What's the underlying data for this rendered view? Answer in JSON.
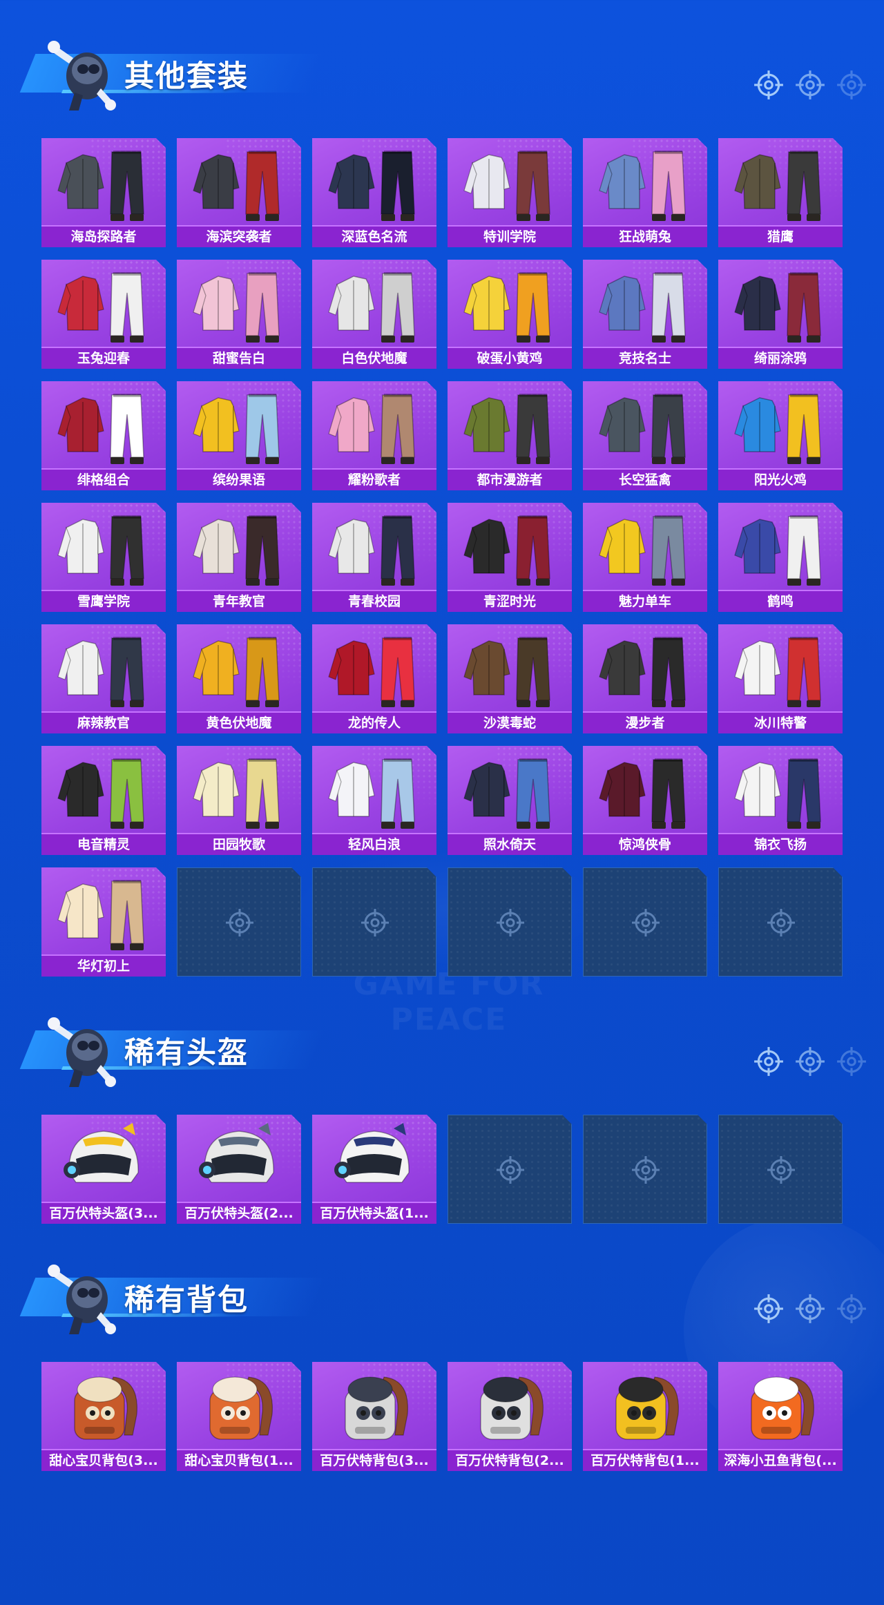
{
  "watermark": "GAME FOR PEACE",
  "sections": [
    {
      "id": "outfits",
      "title": "其他套装",
      "art": "outfit",
      "empty_slots": 5,
      "items": [
        {
          "label": "海岛探路者",
          "c1": "#4a5058",
          "c2": "#2a2e36"
        },
        {
          "label": "海滨突袭者",
          "c1": "#3a3d45",
          "c2": "#b02a2a"
        },
        {
          "label": "深蓝色名流",
          "c1": "#2c3650",
          "c2": "#1a1f2e"
        },
        {
          "label": "特训学院",
          "c1": "#e8e8f0",
          "c2": "#7a3a3a"
        },
        {
          "label": "狂战萌兔",
          "c1": "#6a8ac8",
          "c2": "#e8a0c8"
        },
        {
          "label": "猎鹰",
          "c1": "#5c5440",
          "c2": "#3a3a3a"
        },
        {
          "label": "玉兔迎春",
          "c1": "#c82a3a",
          "c2": "#f0f0f0"
        },
        {
          "label": "甜蜜告白",
          "c1": "#f2c4d6",
          "c2": "#e8a0c0"
        },
        {
          "label": "白色伏地魔",
          "c1": "#e6e6e6",
          "c2": "#cfcfcf"
        },
        {
          "label": "破蛋小黄鸡",
          "c1": "#f5d23a",
          "c2": "#f0a020"
        },
        {
          "label": "竞技名士",
          "c1": "#5c78c0",
          "c2": "#d8dce8"
        },
        {
          "label": "绮丽涂鸦",
          "c1": "#2a2e48",
          "c2": "#8a2a3a"
        },
        {
          "label": "绯格组合",
          "c1": "#a82030",
          "c2": "#ffffff"
        },
        {
          "label": "缤纷果语",
          "c1": "#f2c020",
          "c2": "#9ec8e8"
        },
        {
          "label": "耀粉歌者",
          "c1": "#f0a8c8",
          "c2": "#b08870"
        },
        {
          "label": "都市漫游者",
          "c1": "#6a7a30",
          "c2": "#3a3a3a"
        },
        {
          "label": "长空猛禽",
          "c1": "#4a5560",
          "c2": "#3a4048"
        },
        {
          "label": "阳光火鸡",
          "c1": "#2a8ae0",
          "c2": "#f2c020"
        },
        {
          "label": "雪鹰学院",
          "c1": "#f0f0f0",
          "c2": "#303030"
        },
        {
          "label": "青年教官",
          "c1": "#e8e0d8",
          "c2": "#3a2a2a"
        },
        {
          "label": "青春校园",
          "c1": "#e8e8e8",
          "c2": "#2a3048"
        },
        {
          "label": "青涩时光",
          "c1": "#2a2a2a",
          "c2": "#8a2030"
        },
        {
          "label": "魅力单车",
          "c1": "#f2c820",
          "c2": "#7a8aa0"
        },
        {
          "label": "鹤鸣",
          "c1": "#3a4aa8",
          "c2": "#f0f0f0"
        },
        {
          "label": "麻辣教官",
          "c1": "#f0f0f0",
          "c2": "#303848"
        },
        {
          "label": "黄色伏地魔",
          "c1": "#f0b020",
          "c2": "#d89818"
        },
        {
          "label": "龙的传人",
          "c1": "#b01828",
          "c2": "#e83040"
        },
        {
          "label": "沙漠毒蛇",
          "c1": "#6a4a30",
          "c2": "#4a3a28"
        },
        {
          "label": "漫步者",
          "c1": "#3a3a3a",
          "c2": "#2a2a2a"
        },
        {
          "label": "冰川特警",
          "c1": "#f4f4f4",
          "c2": "#d03030"
        },
        {
          "label": "电音精灵",
          "c1": "#2a2a2a",
          "c2": "#8ac040"
        },
        {
          "label": "田园牧歌",
          "c1": "#f4ecc8",
          "c2": "#e8d890"
        },
        {
          "label": "轻风白浪",
          "c1": "#f4f4f8",
          "c2": "#a8c8e8"
        },
        {
          "label": "照水倚天",
          "c1": "#2a3048",
          "c2": "#4a78c8"
        },
        {
          "label": "惊鸿侠骨",
          "c1": "#5a1a2a",
          "c2": "#2a2a2a"
        },
        {
          "label": "锦衣飞扬",
          "c1": "#f4f4f4",
          "c2": "#2a3868"
        },
        {
          "label": "华灯初上",
          "c1": "#f6e6c8",
          "c2": "#d8b890"
        }
      ]
    },
    {
      "id": "helmets",
      "title": "稀有头盔",
      "art": "helmet",
      "empty_slots": 3,
      "items": [
        {
          "label": "百万伏特头盔(3...",
          "c1": "#f0f0f0",
          "c2": "#f2c020"
        },
        {
          "label": "百万伏特头盔(2...",
          "c1": "#e8e8e8",
          "c2": "#5a6a80"
        },
        {
          "label": "百万伏特头盔(1...",
          "c1": "#f4f4f4",
          "c2": "#2a3a7a"
        }
      ]
    },
    {
      "id": "backpacks",
      "title": "稀有背包",
      "art": "backpack",
      "empty_slots": 0,
      "items": [
        {
          "label": "甜心宝贝背包(3...",
          "c1": "#c85a2a",
          "c2": "#f0e0c0"
        },
        {
          "label": "甜心宝贝背包(1...",
          "c1": "#e06a30",
          "c2": "#f4e8d8"
        },
        {
          "label": "百万伏特背包(3...",
          "c1": "#d8d8d8",
          "c2": "#3a4050"
        },
        {
          "label": "百万伏特背包(2...",
          "c1": "#e0e0e0",
          "c2": "#2a2f3a"
        },
        {
          "label": "百万伏特背包(1...",
          "c1": "#f2c020",
          "c2": "#2a2a2a"
        },
        {
          "label": "深海小丑鱼背包(...",
          "c1": "#f26a20",
          "c2": "#ffffff"
        }
      ]
    }
  ]
}
